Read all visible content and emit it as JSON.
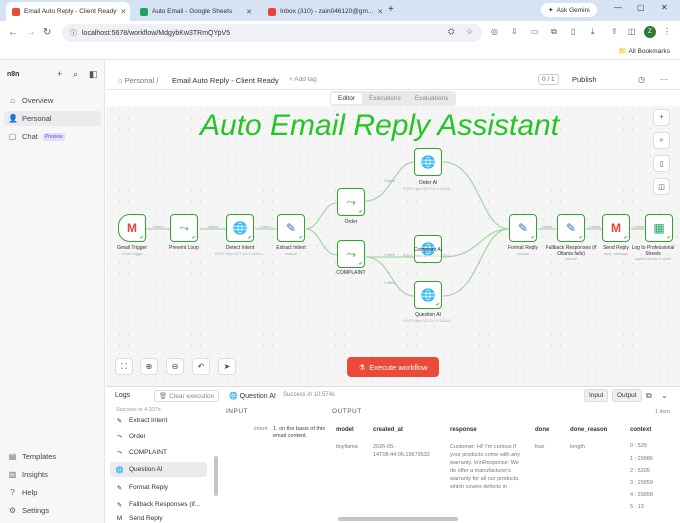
{
  "browser": {
    "tabs": [
      {
        "label": "Email Auto Reply - Client Ready"
      },
      {
        "label": "Auto Email - Google Sheets"
      },
      {
        "label": "Inbox (310) - zain046120@gm..."
      }
    ],
    "new_tab": "+",
    "ask_gemini": "Ask Gemini",
    "url": "localhost:5678/workflow/MdgybKw3TRmQYpV5",
    "all_bookmarks": "All Bookmarks"
  },
  "sidebar": {
    "logo": "n8n",
    "items": [
      {
        "label": "Overview"
      },
      {
        "label": "Personal"
      },
      {
        "label": "Chat",
        "badge": "Preview"
      }
    ],
    "bottom_items": [
      {
        "label": "Templates"
      },
      {
        "label": "Insights"
      },
      {
        "label": "Help"
      },
      {
        "label": "Settings"
      }
    ]
  },
  "header": {
    "breadcrumb": "Personal",
    "separator": "/",
    "title": "Email Auto Reply - Client Ready",
    "add_tag": "+ Add tag",
    "counter": "0 / 1",
    "publish": "Publish"
  },
  "view_tabs": [
    "Editor",
    "Executions",
    "Evaluations"
  ],
  "canvas": {
    "heading": "Auto Email Reply Assistant",
    "heading_color": "#27c427",
    "nodes": [
      {
        "label": "Gmail Trigger",
        "sub": "Gmail Trigger"
      },
      {
        "label": "Prevent Loop",
        "sub": ""
      },
      {
        "label": "Detect Intent",
        "sub": "POST: http://127.0.0.1:11434/..."
      },
      {
        "label": "Extract Intent",
        "sub": "manual"
      },
      {
        "label": "Order",
        "sub": ""
      },
      {
        "label": "COMPLAINT",
        "sub": ""
      },
      {
        "label": "Order AI",
        "sub": "POST: http://127.0.0.1:11434/..."
      },
      {
        "label": "Complaint AI",
        "sub": "POST: http://127.0.0.1:11434/..."
      },
      {
        "label": "Question AI",
        "sub": "POST: http://127.0.0.1:11434/..."
      },
      {
        "label": "Format Reply",
        "sub": "manual"
      },
      {
        "label": "Fallback Responses (if Ollama fails)",
        "sub": "manual"
      },
      {
        "label": "Send Reply",
        "sub": "reply: message"
      },
      {
        "label": "Log to Professional Sheets",
        "sub": "append (rows) in sheet"
      }
    ],
    "edge_labels": [
      "1 item",
      "1 item",
      "1 item",
      "1 item",
      "1 item",
      "1 item",
      "1 item",
      "1 item",
      "1 item"
    ],
    "execute_button": "Execute workflow"
  },
  "logs": {
    "title": "Logs",
    "clear": "Clear execution",
    "run_node": "Question AI",
    "run_status": "Success in 10.574s",
    "success_total": "Success in 4.337s",
    "items": [
      {
        "label": "Extract Intent"
      },
      {
        "label": "Order"
      },
      {
        "label": "COMPLAINT"
      },
      {
        "label": "Question AI"
      },
      {
        "label": "Format Reply"
      },
      {
        "label": "Fallback Responses (if..."
      },
      {
        "label": "Send Reply"
      }
    ],
    "input_btn": "Input",
    "output_btn": "Output",
    "input_title": "INPUT",
    "output_title": "OUTPUT",
    "item_count": "1 item",
    "input_key": "intent",
    "input_text": "1. on the basis of this email content.",
    "columns": [
      "model",
      "created_at",
      "response",
      "done",
      "done_reason",
      "context"
    ],
    "row": {
      "model": "tinyllama",
      "created_at": "2026-05-14T08:44:06.19673532",
      "response": "Customer: Hi! I'm curious if your products come with any warranty. \\n\\nResponse: We do offer a manufacturer's warranty for all our products, which covers defects in",
      "done": "true",
      "done_reason": "length",
      "context": [
        "0 : 529",
        "1 : 29986",
        "2 : 5205",
        "3 : 29959",
        "4 : 29958",
        "5 : 13"
      ]
    }
  }
}
